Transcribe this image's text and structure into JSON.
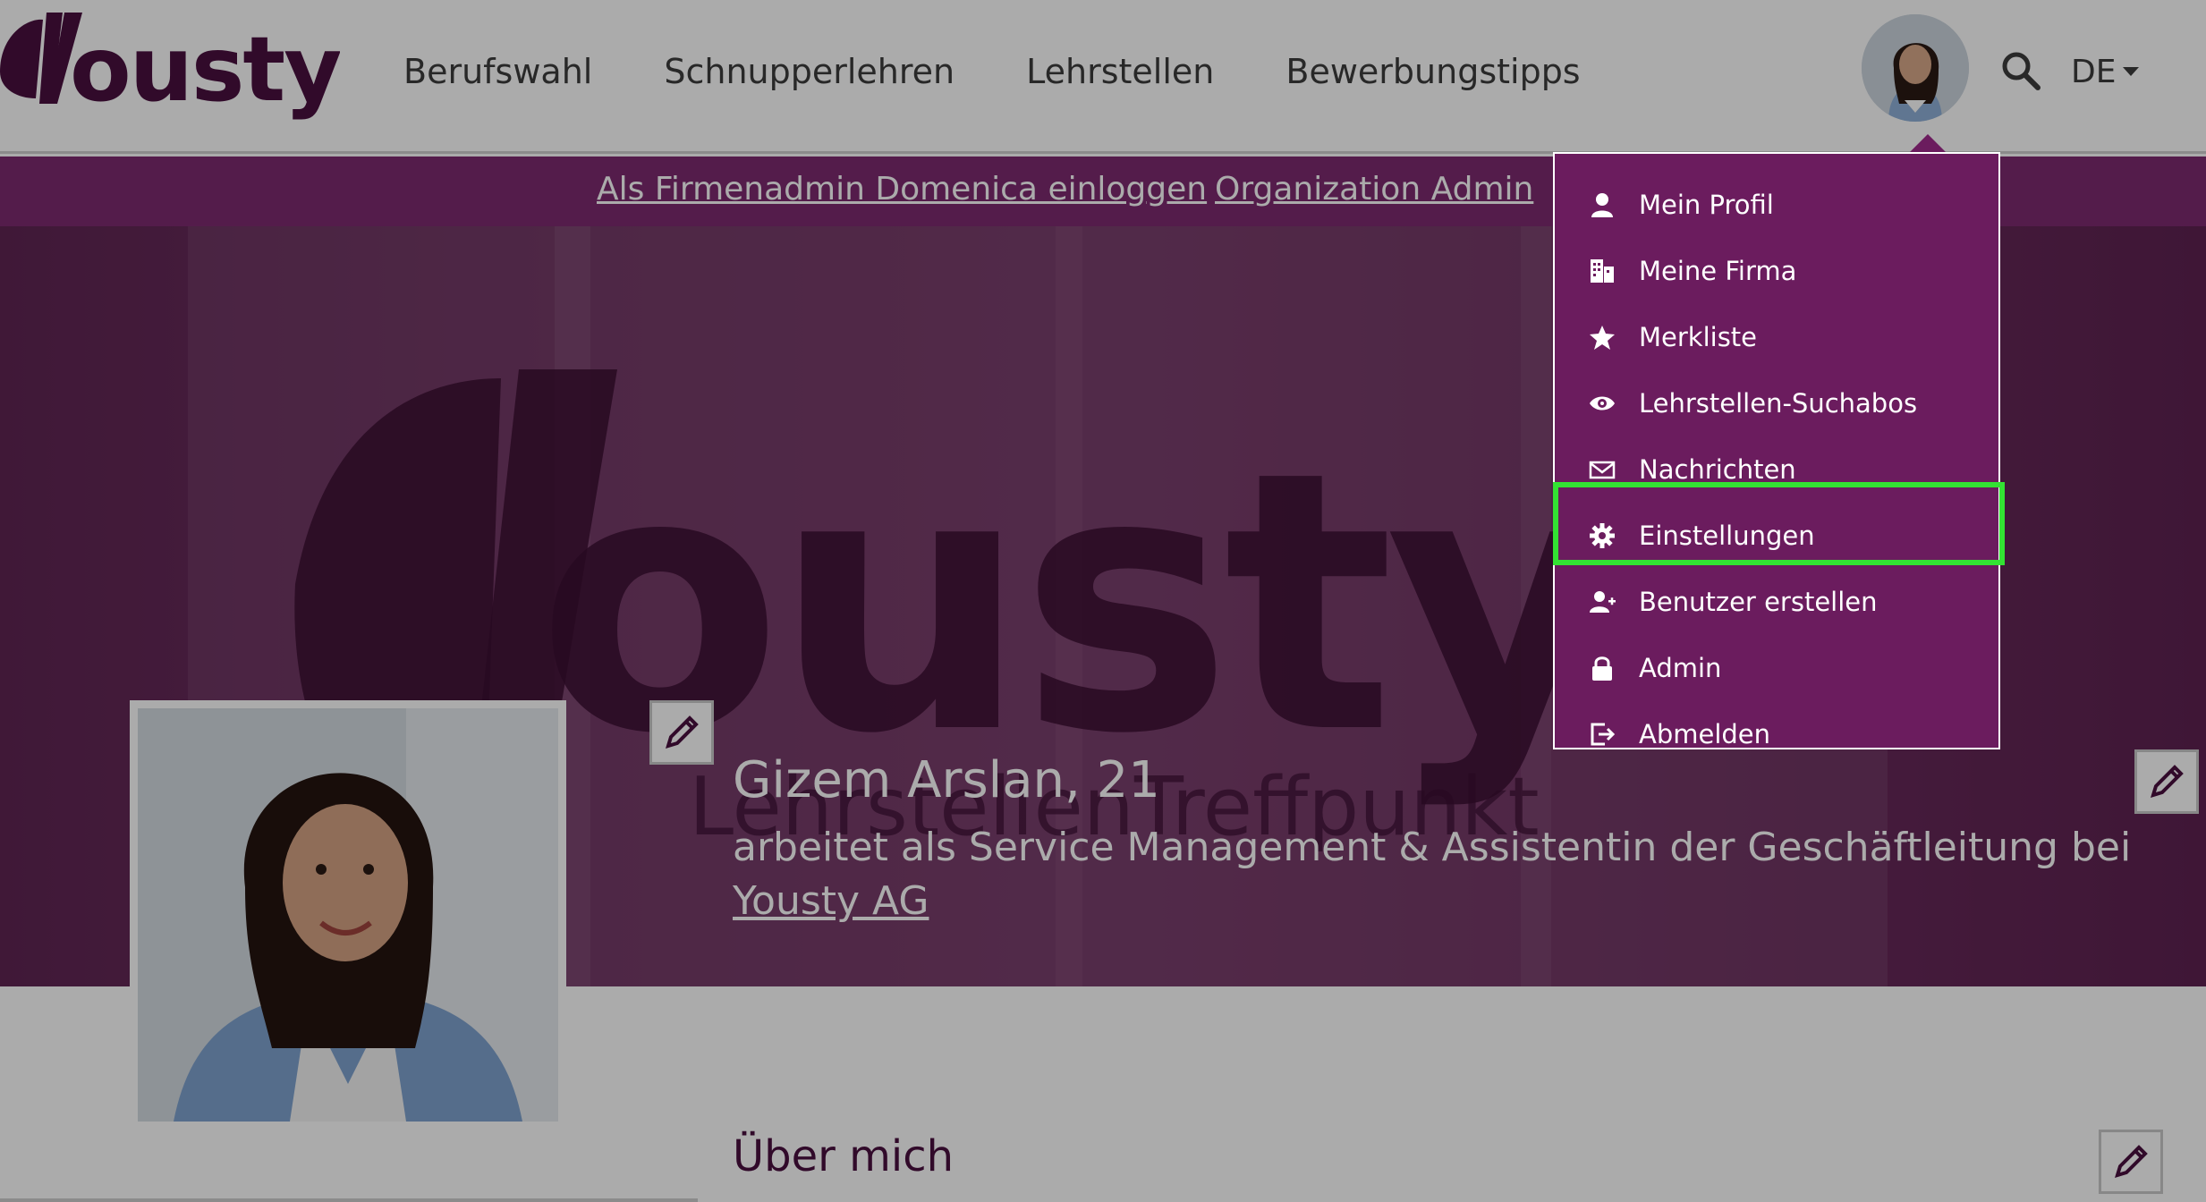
{
  "header": {
    "logo_text": "yousty",
    "nav": [
      "Berufswahl",
      "Schnupperlehren",
      "Lehrstellen",
      "Bewerbungstipps"
    ],
    "lang": "DE"
  },
  "admin_bar": {
    "link_login": "Als Firmenadmin Domenica einloggen",
    "link_org": "Organization Admin"
  },
  "hero": {
    "bg_watermark": "yousty",
    "bg_subtext": "LehrstellenTreffpunkt",
    "name": "Gizem Arslan, 21",
    "job_prefix": "arbeitet als Service Management & Assistentin der Geschäftleitung bei ",
    "company": "Yousty AG"
  },
  "about": {
    "title": "Über mich"
  },
  "dropdown": {
    "items": [
      {
        "label": "Mein Profil",
        "icon": "user-icon"
      },
      {
        "label": "Meine Firma",
        "icon": "building-icon"
      },
      {
        "label": "Merkliste",
        "icon": "star-icon"
      },
      {
        "label": "Lehrstellen-Suchabos",
        "icon": "eye-icon"
      },
      {
        "label": "Nachrichten",
        "icon": "envelope-icon"
      },
      {
        "label": "Einstellungen",
        "icon": "gear-icon"
      },
      {
        "label": "Benutzer erstellen",
        "icon": "user-plus-icon"
      },
      {
        "label": "Admin",
        "icon": "lock-icon"
      },
      {
        "label": "Abmelden",
        "icon": "logout-icon"
      }
    ],
    "highlighted": "Einstellungen"
  },
  "colors": {
    "brand": "#4a0f3f",
    "admin_bar": "#7e2a71",
    "dropdown_bg": "#6b1c5e",
    "highlight": "#33e233"
  }
}
